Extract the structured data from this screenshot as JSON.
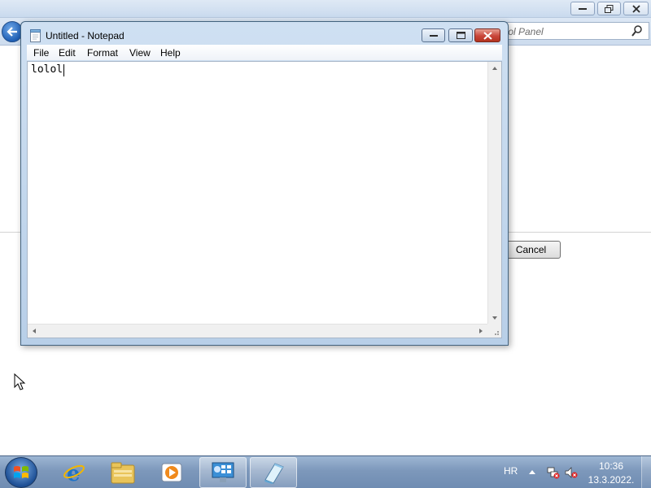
{
  "background_window": {
    "search_placeholder": "trol Panel",
    "cancel_label": "Cancel"
  },
  "notepad": {
    "title": "Untitled - Notepad",
    "menu": [
      "File",
      "Edit",
      "Format",
      "View",
      "Help"
    ],
    "content": "lolol"
  },
  "taskbar": {
    "apps": [
      "internet-explorer",
      "windows-explorer",
      "media-player",
      "control-panel",
      "notepad"
    ],
    "active_app": "notepad"
  },
  "tray": {
    "language": "HR",
    "time": "10:36",
    "date": "13.3.2022."
  },
  "colors": {
    "taskbar": "#7d98bb",
    "close_button": "#c9463a",
    "titlebar": "#cfe0f2"
  }
}
